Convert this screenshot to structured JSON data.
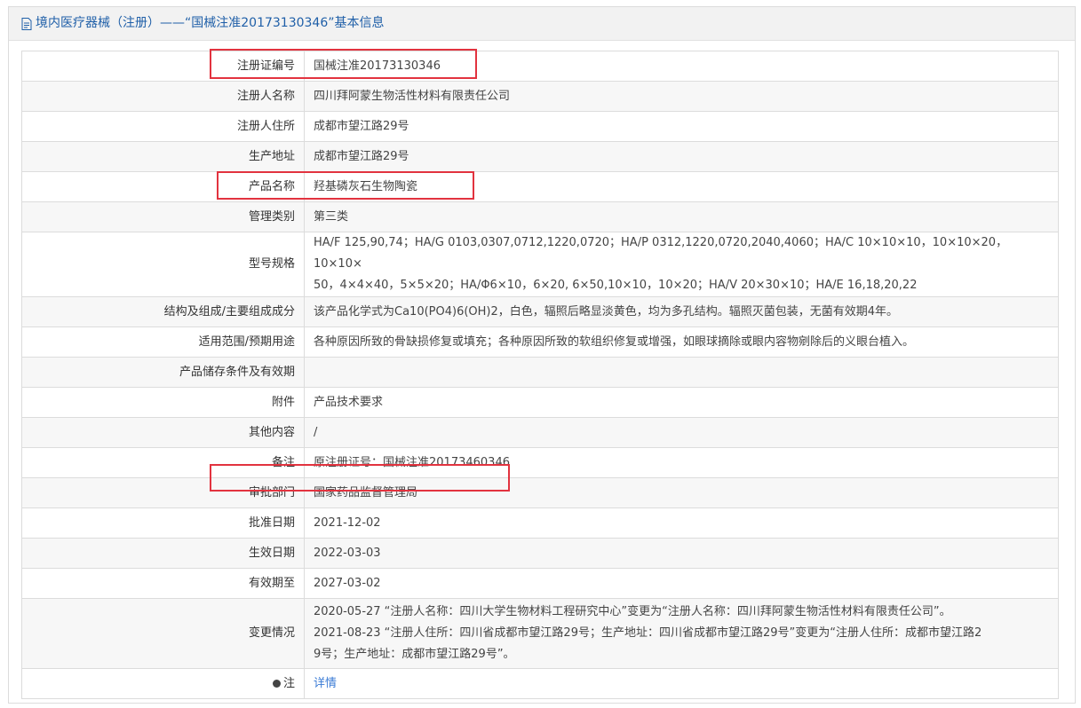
{
  "header": {
    "title": "境内医疗器械（注册）——“国械注准20173130346”基本信息"
  },
  "rows": [
    {
      "label": "注册证编号",
      "value": "国械注准20173130346"
    },
    {
      "label": "注册人名称",
      "value": "四川拜阿蒙生物活性材料有限责任公司"
    },
    {
      "label": "注册人住所",
      "value": "成都市望江路29号"
    },
    {
      "label": "生产地址",
      "value": "成都市望江路29号"
    },
    {
      "label": "产品名称",
      "value": "羟基磷灰石生物陶瓷"
    },
    {
      "label": "管理类别",
      "value": "第三类"
    },
    {
      "label": "型号规格",
      "line1": "HA/F 125,90,74；HA/G 0103,0307,0712,1220,0720；HA/P 0312,1220,0720,2040,4060；HA/C 10×10×10，10×10×20，10×10×",
      "line2": "50，4×4×40，5×5×20；HA/Φ6×10，6×20, 6×50,10×10，10×20；HA/V 20×30×10；HA/E 16,18,20,22"
    },
    {
      "label": "结构及组成/主要组成成分",
      "value": "该产品化学式为Ca10(PO4)6(OH)2，白色，辐照后略显淡黄色，均为多孔结构。辐照灭菌包装，无菌有效期4年。"
    },
    {
      "label": "适用范围/预期用途",
      "value": "各种原因所致的骨缺损修复或填充；各种原因所致的软组织修复或增强，如眼球摘除或眼内容物剜除后的义眼台植入。"
    },
    {
      "label": "产品储存条件及有效期",
      "value": ""
    },
    {
      "label": "附件",
      "value": "产品技术要求"
    },
    {
      "label": "其他内容",
      "value": "/"
    },
    {
      "label": "备注",
      "value": "原注册证号：国械注准20173460346"
    },
    {
      "label": "审批部门",
      "value": "国家药品监督管理局"
    },
    {
      "label": "批准日期",
      "value": "2021-12-02"
    },
    {
      "label": "生效日期",
      "value": "2022-03-03"
    },
    {
      "label": "有效期至",
      "value": "2027-03-02"
    },
    {
      "label": "变更情况",
      "line1": "2020-05-27 “注册人名称：四川大学生物材料工程研究中心”变更为“注册人名称：四川拜阿蒙生物活性材料有限责任公司”。",
      "line2": "2021-08-23 “注册人住所：四川省成都市望江路29号；生产地址：四川省成都市望江路29号”变更为“注册人住所：成都市望江路2",
      "line3": "9号；生产地址：成都市望江路29号”。"
    },
    {
      "label": "注",
      "value": "详情"
    }
  ],
  "colors": {
    "header_text": "#1f5fa8",
    "highlight": "#e2333f",
    "link": "#3a7bd5"
  },
  "icons": {
    "header": "document-icon",
    "note": "map-pin-icon"
  }
}
